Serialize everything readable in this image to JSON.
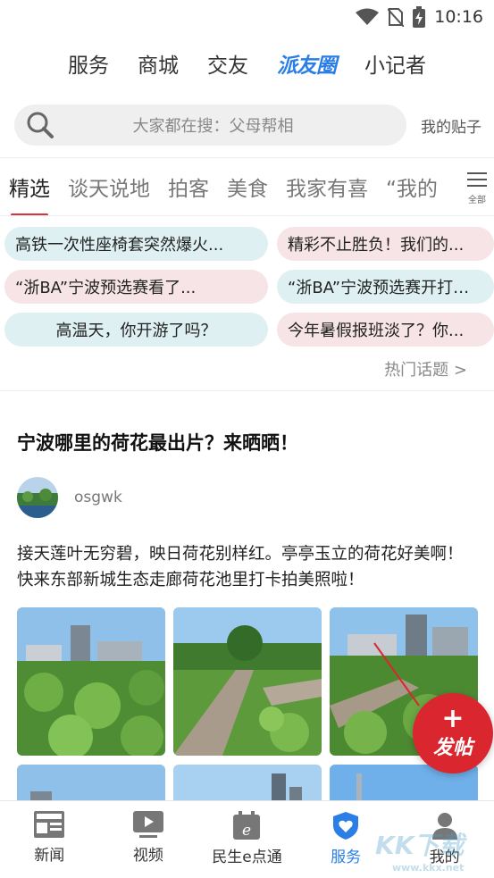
{
  "status": {
    "time": "10:16"
  },
  "top_nav": [
    "服务",
    "商城",
    "交友",
    "派友圈",
    "小记者"
  ],
  "search": {
    "placeholder": "大家都在搜：父母帮相",
    "my_posts": "我的贴子"
  },
  "categories": {
    "items": [
      "精选",
      "谈天说地",
      "拍客",
      "美食",
      "我家有喜",
      "“我的"
    ],
    "more_label": "全部"
  },
  "hot_topics": {
    "chips": [
      "高铁一次性座椅套突然爆火...",
      "精彩不止胜负！我们的...",
      "“浙BA”宁波预选赛看了...",
      "“浙BA”宁波预选赛开打！一...",
      "高温天，你开游了吗？",
      "今年暑假报班淡了？你..."
    ],
    "more": "热门话题 >"
  },
  "post": {
    "title": "宁波哪里的荷花最出片？来晒晒！",
    "author": "osgwk",
    "text": "接天莲叶无穷碧，映日荷花别样红。亭亭玉立的荷花好美啊！快来东部新城生态走廊荷花池里打卡拍美照啦！"
  },
  "fab": {
    "label": "发帖"
  },
  "bottom_nav": [
    "新闻",
    "视频",
    "民生e点通",
    "服务",
    "我的"
  ],
  "colors": {
    "accent": "#2a7ee6",
    "red": "#d9333f"
  },
  "watermark": {
    "logo": "KK下载",
    "url": "www.kkx.net"
  }
}
